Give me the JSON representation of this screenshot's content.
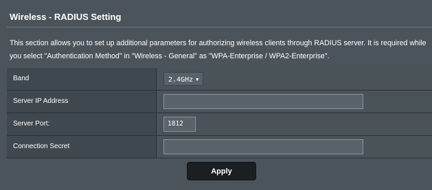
{
  "page": {
    "title": "Wireless - RADIUS Setting",
    "description": [
      "This section allows you to set up additional parameters for authorizing wireless clients through RADIUS server. It is required while",
      "you select \"Authentication Method\" in \"Wireless - General\" as \"WPA-Enterprise / WPA2-Enterprise\"."
    ]
  },
  "form": {
    "band": {
      "label": "Band",
      "value": "2.4GHz"
    },
    "server_ip": {
      "label": "Server IP Address",
      "value": ""
    },
    "server_port": {
      "label": "Server Port:",
      "value": "1812"
    },
    "connection_secret": {
      "label": "Connection Secret",
      "value": ""
    }
  },
  "actions": {
    "apply_label": "Apply"
  },
  "colors": {
    "background": "#4b545a",
    "label_cell": "#3f484e",
    "button": "#1b1f22",
    "text": "#ffffff"
  }
}
